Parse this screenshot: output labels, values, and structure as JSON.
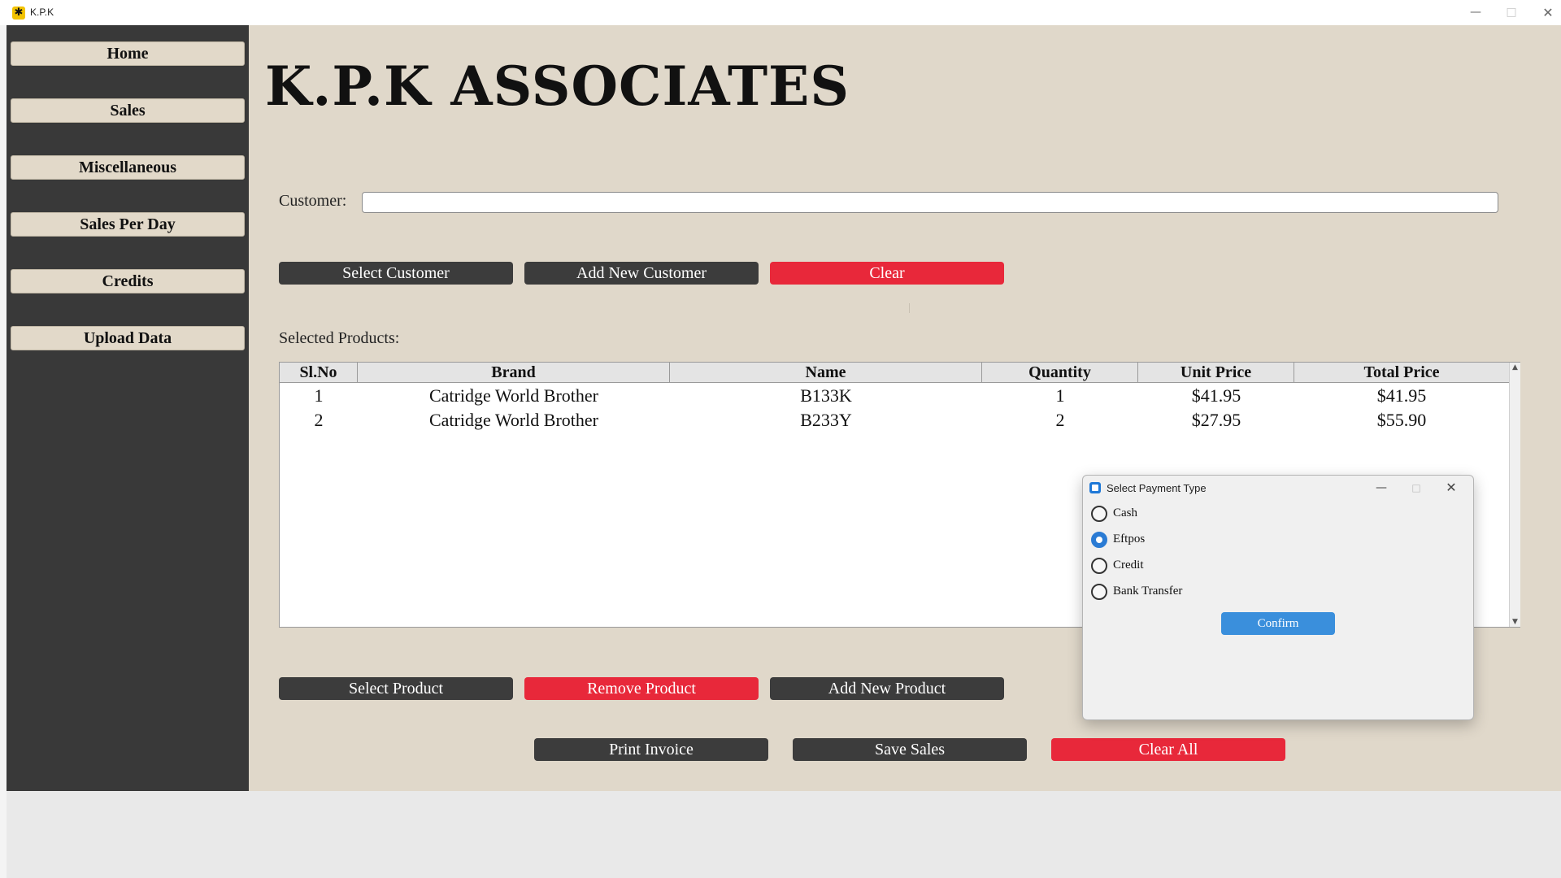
{
  "window": {
    "title": "K.P.K",
    "icon": "app-logo-icon",
    "controls": {
      "minimize": "—",
      "maximize": "□",
      "close": "✕"
    }
  },
  "sidebar": {
    "items": [
      {
        "label": "Home"
      },
      {
        "label": "Sales"
      },
      {
        "label": "Miscellaneous"
      },
      {
        "label": "Sales Per Day"
      },
      {
        "label": "Credits"
      },
      {
        "label": "Upload Data"
      }
    ]
  },
  "main": {
    "company_title": "K.P.K ASSOCIATES",
    "customer_label": "Customer:",
    "customer_value": "",
    "customer_buttons": {
      "select": "Select Customer",
      "add_new": "Add New Customer",
      "clear": "Clear"
    },
    "selected_products_label": "Selected Products:",
    "table": {
      "columns": [
        "Sl.No",
        "Brand",
        "Name",
        "Quantity",
        "Unit Price",
        "Total Price"
      ],
      "rows": [
        {
          "sl_no": "1",
          "brand": "Catridge World Brother",
          "name": "B133K",
          "quantity": "1",
          "unit_price": "$41.95",
          "total_price": "$41.95"
        },
        {
          "sl_no": "2",
          "brand": "Catridge World Brother",
          "name": "B233Y",
          "quantity": "2",
          "unit_price": "$27.95",
          "total_price": "$55.90"
        }
      ]
    },
    "product_buttons": {
      "select": "Select Product",
      "remove": "Remove Product",
      "add_new": "Add New Product"
    },
    "bottom_buttons": {
      "print_invoice": "Print Invoice",
      "save_sales": "Save Sales",
      "clear_all": "Clear All"
    }
  },
  "payment_dialog": {
    "title": "Select Payment Type",
    "controls": {
      "minimize": "—",
      "maximize": "□",
      "close": "✕"
    },
    "options": [
      {
        "label": "Cash",
        "selected": false
      },
      {
        "label": "Eftpos",
        "selected": true
      },
      {
        "label": "Credit",
        "selected": false
      },
      {
        "label": "Bank Transfer",
        "selected": false
      }
    ],
    "confirm_label": "Confirm"
  },
  "colors": {
    "sidebar_bg": "#393939",
    "content_bg": "#e0d8ca",
    "nav_button_bg": "#e2d9c9",
    "dark_button": "#3c3c3c",
    "danger_button": "#e8283a",
    "confirm_button": "#3a8fdc",
    "radio_selected": "#2a7bd4"
  }
}
